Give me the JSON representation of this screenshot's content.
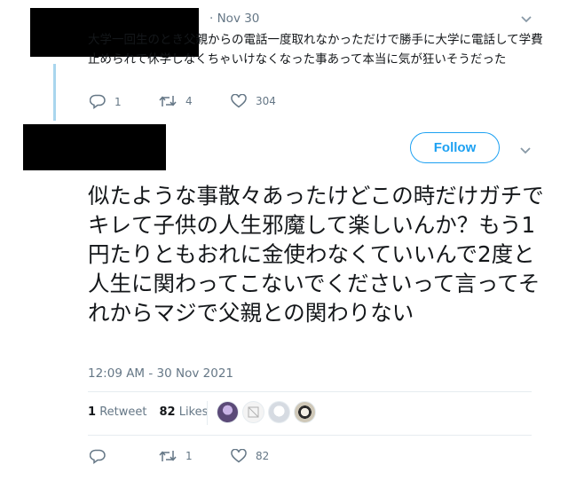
{
  "parent_tweet": {
    "date": "· Nov 30",
    "text": "大学一回生のとき父親からの電話一度取れなかっただけで勝手に大学に電話して学費止められて休学しなくちゃいけなくなった事あって本当に気が狂いそうだった",
    "replies": "1",
    "retweets": "4",
    "likes": "304"
  },
  "main_tweet": {
    "follow_label": "Follow",
    "text": "似たような事散々あったけどこの時だけガチでキレて子供の人生邪魔して楽しいんか？もう1円たりともおれに金使わなくていいんで2度と人生に関わってこないでくださいって言ってそれからマジで父親との関わりない",
    "timestamp": "12:09 AM - 30 Nov 2021",
    "retweet_count": "1",
    "retweet_label": "Retweet",
    "like_count": "82",
    "like_label": "Likes",
    "action_retweets": "1",
    "action_likes": "82"
  },
  "icons": {
    "reply": "reply-icon",
    "retweet": "retweet-icon",
    "like": "heart-icon",
    "more": "chevron-down-icon"
  },
  "colors": {
    "accent": "#1da1f2",
    "muted": "#657786",
    "reply_thread_line": "#a9d6ee"
  }
}
